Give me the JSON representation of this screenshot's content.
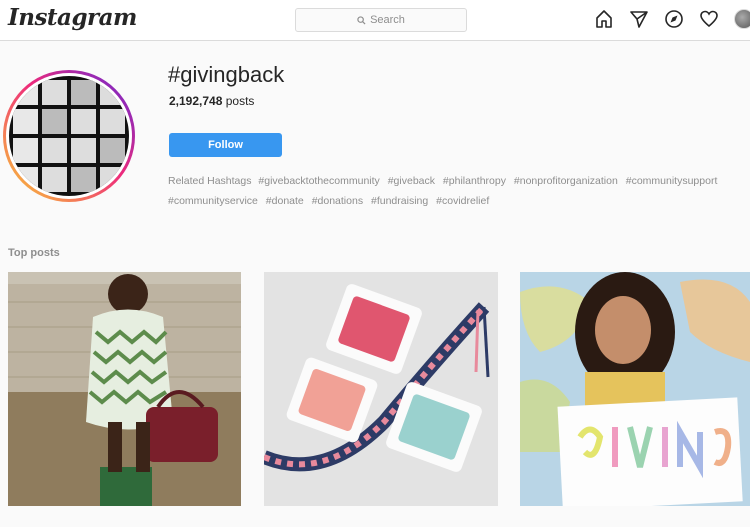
{
  "header": {
    "logo": "Instagram",
    "search_placeholder": "Search",
    "icons": [
      "home-icon",
      "direct-icon",
      "explore-icon",
      "activity-heart-icon",
      "profile-avatar"
    ]
  },
  "hashtag": {
    "title": "#givingback",
    "post_count": "2,192,748",
    "post_count_suffix": "posts",
    "follow_label": "Follow"
  },
  "related": {
    "label": "Related Hashtags",
    "tags": [
      "#givebacktothecommunity",
      "#giveback",
      "#philanthropy",
      "#nonprofitorganization",
      "#communitysupport",
      "#communityservice",
      "#donate",
      "#donations",
      "#fundraising",
      "#covidrelief"
    ]
  },
  "top_posts": {
    "label": "Top posts",
    "items": [
      {
        "subject": "girl holding handbag outdoors"
      },
      {
        "subject": "embroidery thread spools and friendship bracelet"
      },
      {
        "subject": "girl holding giving sign in front of map"
      }
    ]
  },
  "colors": {
    "accent": "#3897f0",
    "text": "#262626",
    "muted": "#8e8e8e",
    "background": "#fafafa"
  }
}
